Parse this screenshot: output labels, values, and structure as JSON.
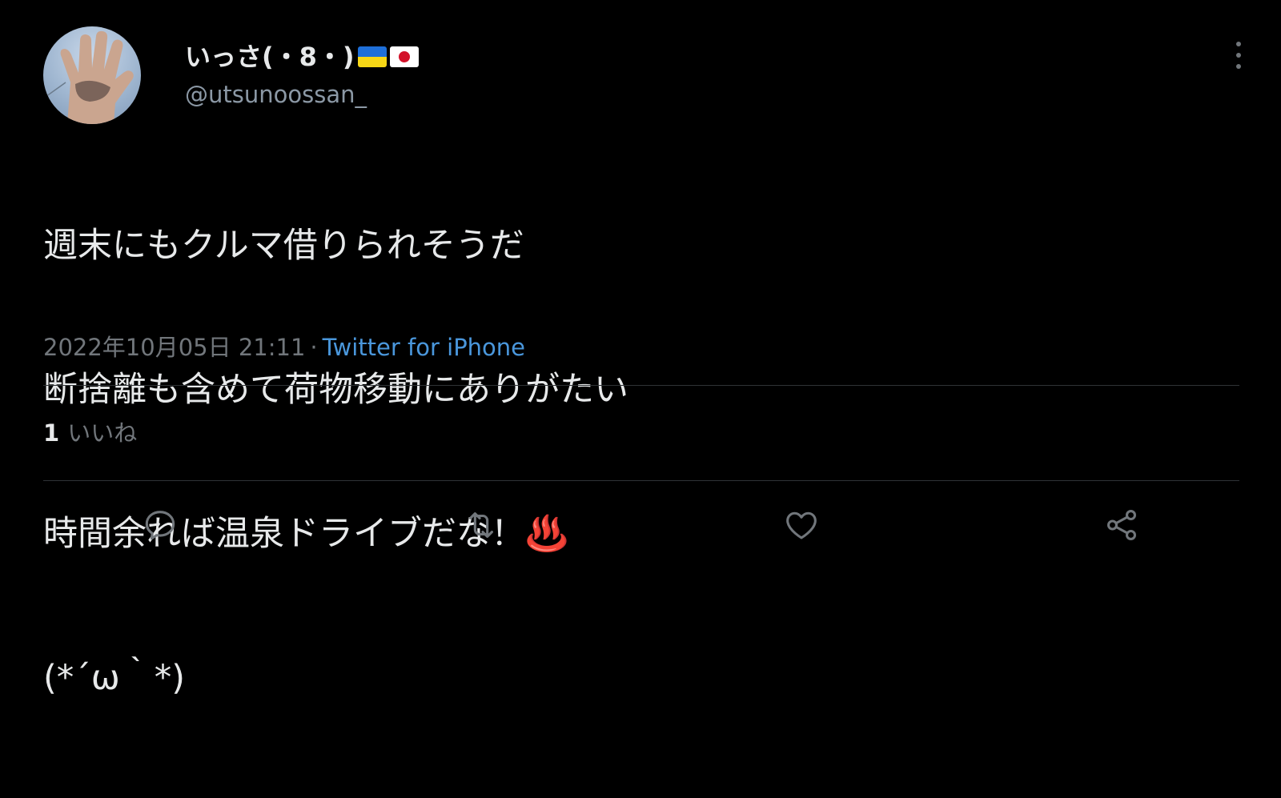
{
  "tweet": {
    "author": {
      "display_name": "いっさ(・8・)",
      "flags": [
        "ukraine-flag",
        "japan-flag"
      ],
      "handle": "@utsunoossan_"
    },
    "text_lines": [
      "週末にもクルマ借りられそうだ",
      "断捨離も含めて荷物移動にありがたい",
      "時間余れば温泉ドライブだな！♨️",
      "(*´ω｀*)"
    ],
    "timestamp": "2022年10月05日 21:11",
    "separator": "·",
    "source": "Twitter for iPhone",
    "likes": {
      "count": "1",
      "label": "いいね"
    }
  },
  "actions": {
    "reply": "reply-icon",
    "retweet": "retweet-icon",
    "like": "heart-icon",
    "share": "share-icon"
  },
  "colors": {
    "background": "#000000",
    "text_primary": "#e7e9ea",
    "text_secondary": "#71767b",
    "link": "#4a97dc",
    "divider": "#2f3336"
  }
}
